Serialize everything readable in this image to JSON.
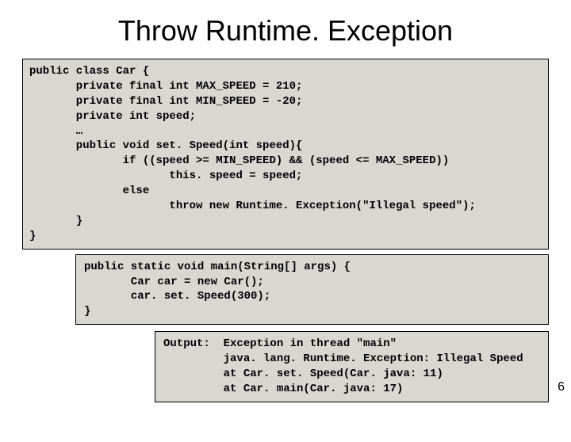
{
  "title": "Throw Runtime. Exception",
  "code1": "public class Car {\n       private final int MAX_SPEED = 210;\n       private final int MIN_SPEED = -20;\n       private int speed;\n       …\n       public void set. Speed(int speed){\n              if ((speed >= MIN_SPEED) && (speed <= MAX_SPEED))\n                     this. speed = speed;\n              else\n                     throw new Runtime. Exception(\"Illegal speed\");\n       }\n}",
  "code2": "public static void main(String[] args) {\n       Car car = new Car();\n       car. set. Speed(300);\n}",
  "code3": "Output:  Exception in thread \"main\"\n         java. lang. Runtime. Exception: Illegal Speed\n         at Car. set. Speed(Car. java: 11)\n         at Car. main(Car. java: 17)",
  "page_number": "6"
}
